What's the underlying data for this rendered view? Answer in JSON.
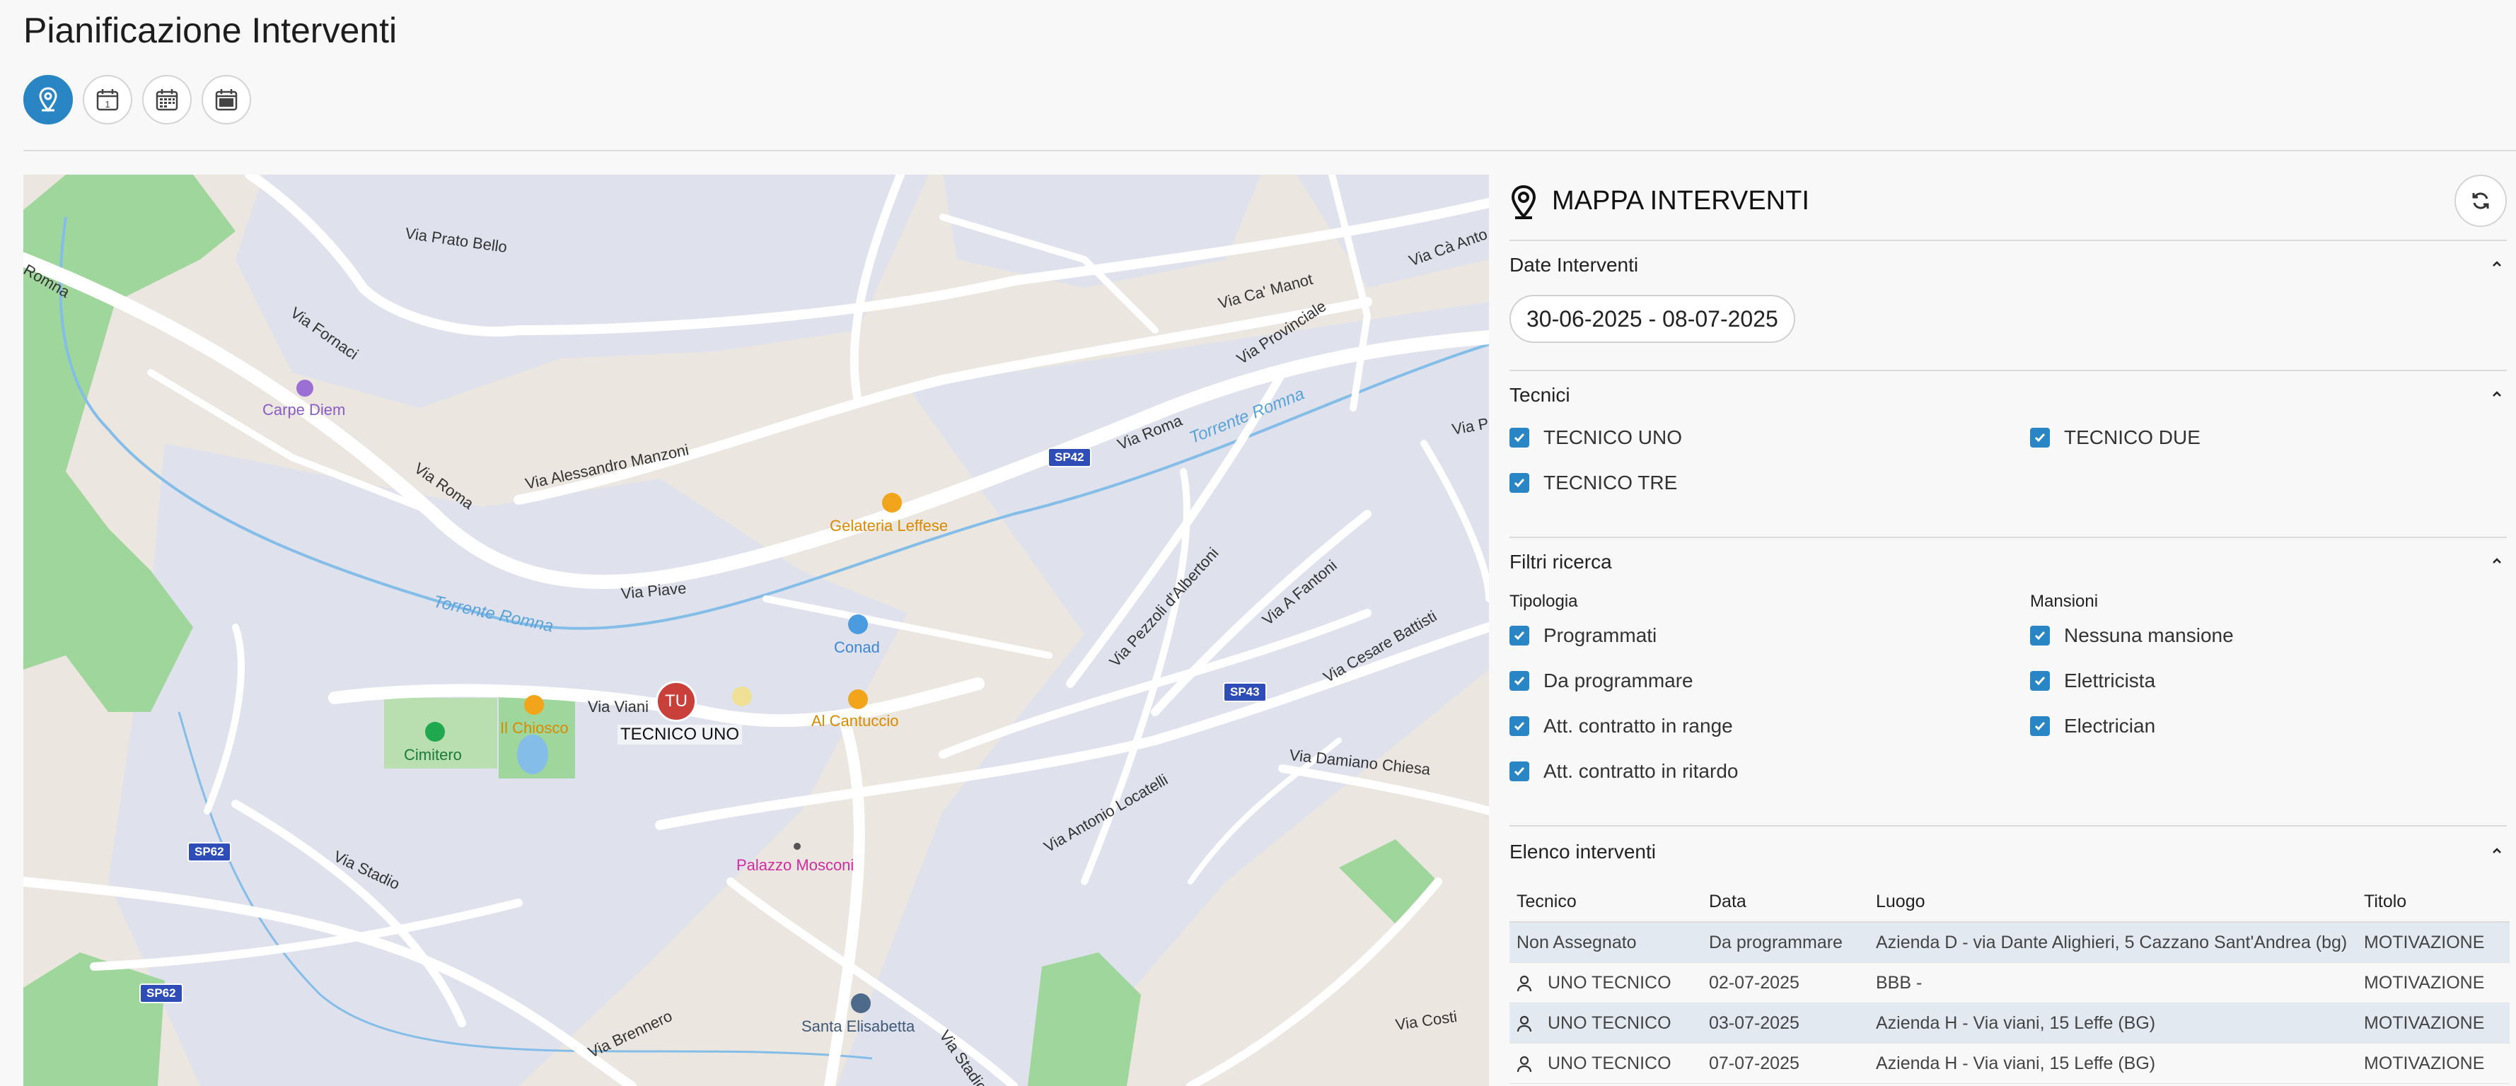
{
  "page": {
    "title": "Pianificazione Interventi"
  },
  "view_buttons": [
    {
      "icon": "map-pin-icon",
      "active": true
    },
    {
      "icon": "calendar-day-icon",
      "active": false
    },
    {
      "icon": "calendar-month-icon",
      "active": false
    },
    {
      "icon": "calendar-nov-icon",
      "active": false
    }
  ],
  "map": {
    "streets": [
      "Via Prato Bello",
      "Romna",
      "Via Fornaci",
      "Via Roma",
      "Via Alessandro Manzoni",
      "Via Piave",
      "Via Viani",
      "Via Stadio",
      "Via Brennero",
      "Via Ca' Manot",
      "Via Provinciale",
      "Via Roma",
      "Via Pezzoli d'Albertoni",
      "Via A Fantoni",
      "Via Cesare Battisti",
      "Via Damiano Chiesa",
      "Via Antonio Locatelli",
      "Via Costi",
      "Via Stadio",
      "Via Cà Anto",
      "Via Pr"
    ],
    "water": [
      "Torrente Romna",
      "Torrente Romna"
    ],
    "pois": {
      "carpe_diem": "Carpe Diem",
      "gelateria": "Gelateria Leffese",
      "conad": "Conad",
      "al_cantuccio": "Al Cantuccio",
      "il_chiosco": "Il Chiosco",
      "cimitero": "Cimitero",
      "palazzo": "Palazzo Mosconi",
      "santa_elisabetta": "Santa Elisabetta"
    },
    "shields": {
      "sp42": "SP42",
      "sp43": "SP43",
      "sp62a": "SP62",
      "sp62b": "SP62"
    },
    "marker": {
      "initials": "TU",
      "label": "TECNICO UNO",
      "color": "#c9403a"
    }
  },
  "panel": {
    "title": "MAPPA INTERVENTI",
    "date_section": {
      "title": "Date Interventi",
      "range": "30-06-2025 - 08-07-2025"
    },
    "tecnici_section": {
      "title": "Tecnici",
      "items": [
        "TECNICO UNO",
        "TECNICO DUE",
        "TECNICO TRE"
      ]
    },
    "filtri_section": {
      "title": "Filtri ricerca",
      "tipologia_label": "Tipologia",
      "tipologia": [
        "Programmati",
        "Da programmare",
        "Att. contratto in range",
        "Att. contratto in ritardo"
      ],
      "mansioni_label": "Mansioni",
      "mansioni": [
        "Nessuna mansione",
        "Elettricista",
        "Electrician"
      ]
    },
    "elenco_section": {
      "title": "Elenco interventi",
      "columns": [
        "Tecnico",
        "Data",
        "Luogo",
        "Titolo"
      ],
      "rows": [
        {
          "tecnico": "Non Assegnato",
          "data": "Da programmare",
          "luogo": "Azienda D - via Dante Alighieri, 5 Cazzano Sant'Andrea (bg)",
          "titolo": "MOTIVAZIONE"
        },
        {
          "tecnico": "UNO TECNICO",
          "data": "02-07-2025",
          "luogo": "BBB -",
          "titolo": "MOTIVAZIONE"
        },
        {
          "tecnico": "UNO TECNICO",
          "data": "03-07-2025",
          "luogo": "Azienda H - Via viani, 15 Leffe (BG)",
          "titolo": "MOTIVAZIONE"
        },
        {
          "tecnico": "UNO TECNICO",
          "data": "07-07-2025",
          "luogo": "Azienda H - Via viani, 15 Leffe (BG)",
          "titolo": "MOTIVAZIONE"
        }
      ]
    }
  },
  "colors": {
    "accent": "#2a85c4",
    "map_land": "#ebe6df",
    "map_urban": "#dfe1ec",
    "map_green": "#9fd69b",
    "map_water": "#84bde8"
  }
}
